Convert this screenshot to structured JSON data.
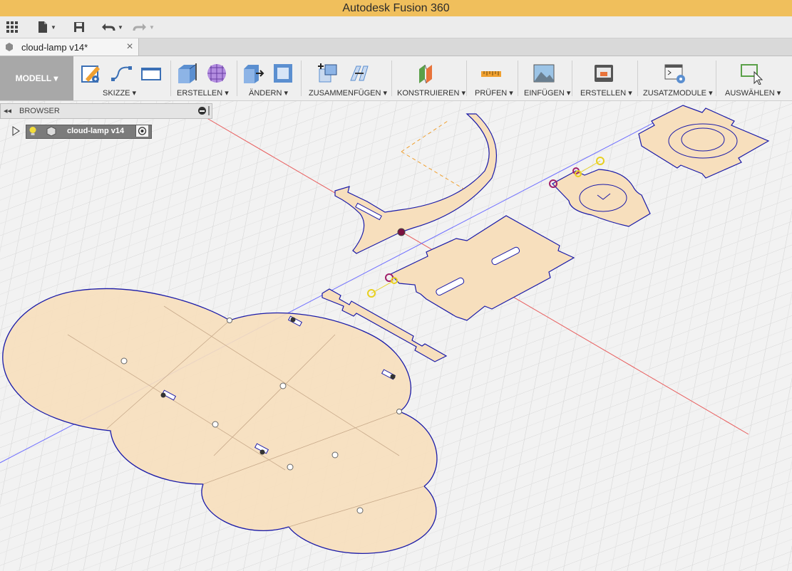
{
  "window": {
    "title": "Autodesk Fusion 360"
  },
  "document_tab": {
    "label": "cloud-lamp v14*",
    "close": "×"
  },
  "workspace": {
    "label": "MODELL ▾"
  },
  "ribbon_groups": [
    {
      "label": "SKIZZE ▾"
    },
    {
      "label": "ERSTELLEN ▾"
    },
    {
      "label": "ÄNDERN ▾"
    },
    {
      "label": "ZUSAMMENFÜGEN ▾"
    },
    {
      "label": "KONSTRUIEREN ▾"
    },
    {
      "label": "PRÜFEN ▾"
    },
    {
      "label": "EINFÜGEN ▾"
    },
    {
      "label": "ERSTELLEN ▾"
    },
    {
      "label": "ZUSATZMODULE ▾"
    },
    {
      "label": "AUSWÄHLEN ▾"
    }
  ],
  "browser": {
    "title": "BROWSER",
    "node_label": "cloud-lamp v14"
  },
  "icons": {
    "qat": [
      "grid-menu-icon",
      "file-icon",
      "save-icon",
      "undo-icon",
      "redo-icon"
    ],
    "ribbon": [
      "create-sketch-icon",
      "spline-icon",
      "rectangle-icon",
      "extrude-icon",
      "form-icon",
      "press-pull-icon",
      "shell-icon",
      "new-component-icon",
      "joint-icon",
      "offset-plane-icon",
      "measure-icon",
      "insert-image-icon",
      "3d-print-icon",
      "scripts-icon",
      "select-icon"
    ]
  },
  "colors": {
    "titlebar": "#f0bf5c",
    "body_fill": "#f7dfbd",
    "body_edge": "#1a1aa8",
    "grid_line": "#d2d2d2",
    "axis_red": "#e85b5b",
    "axis_blue": "#6b6bff"
  }
}
